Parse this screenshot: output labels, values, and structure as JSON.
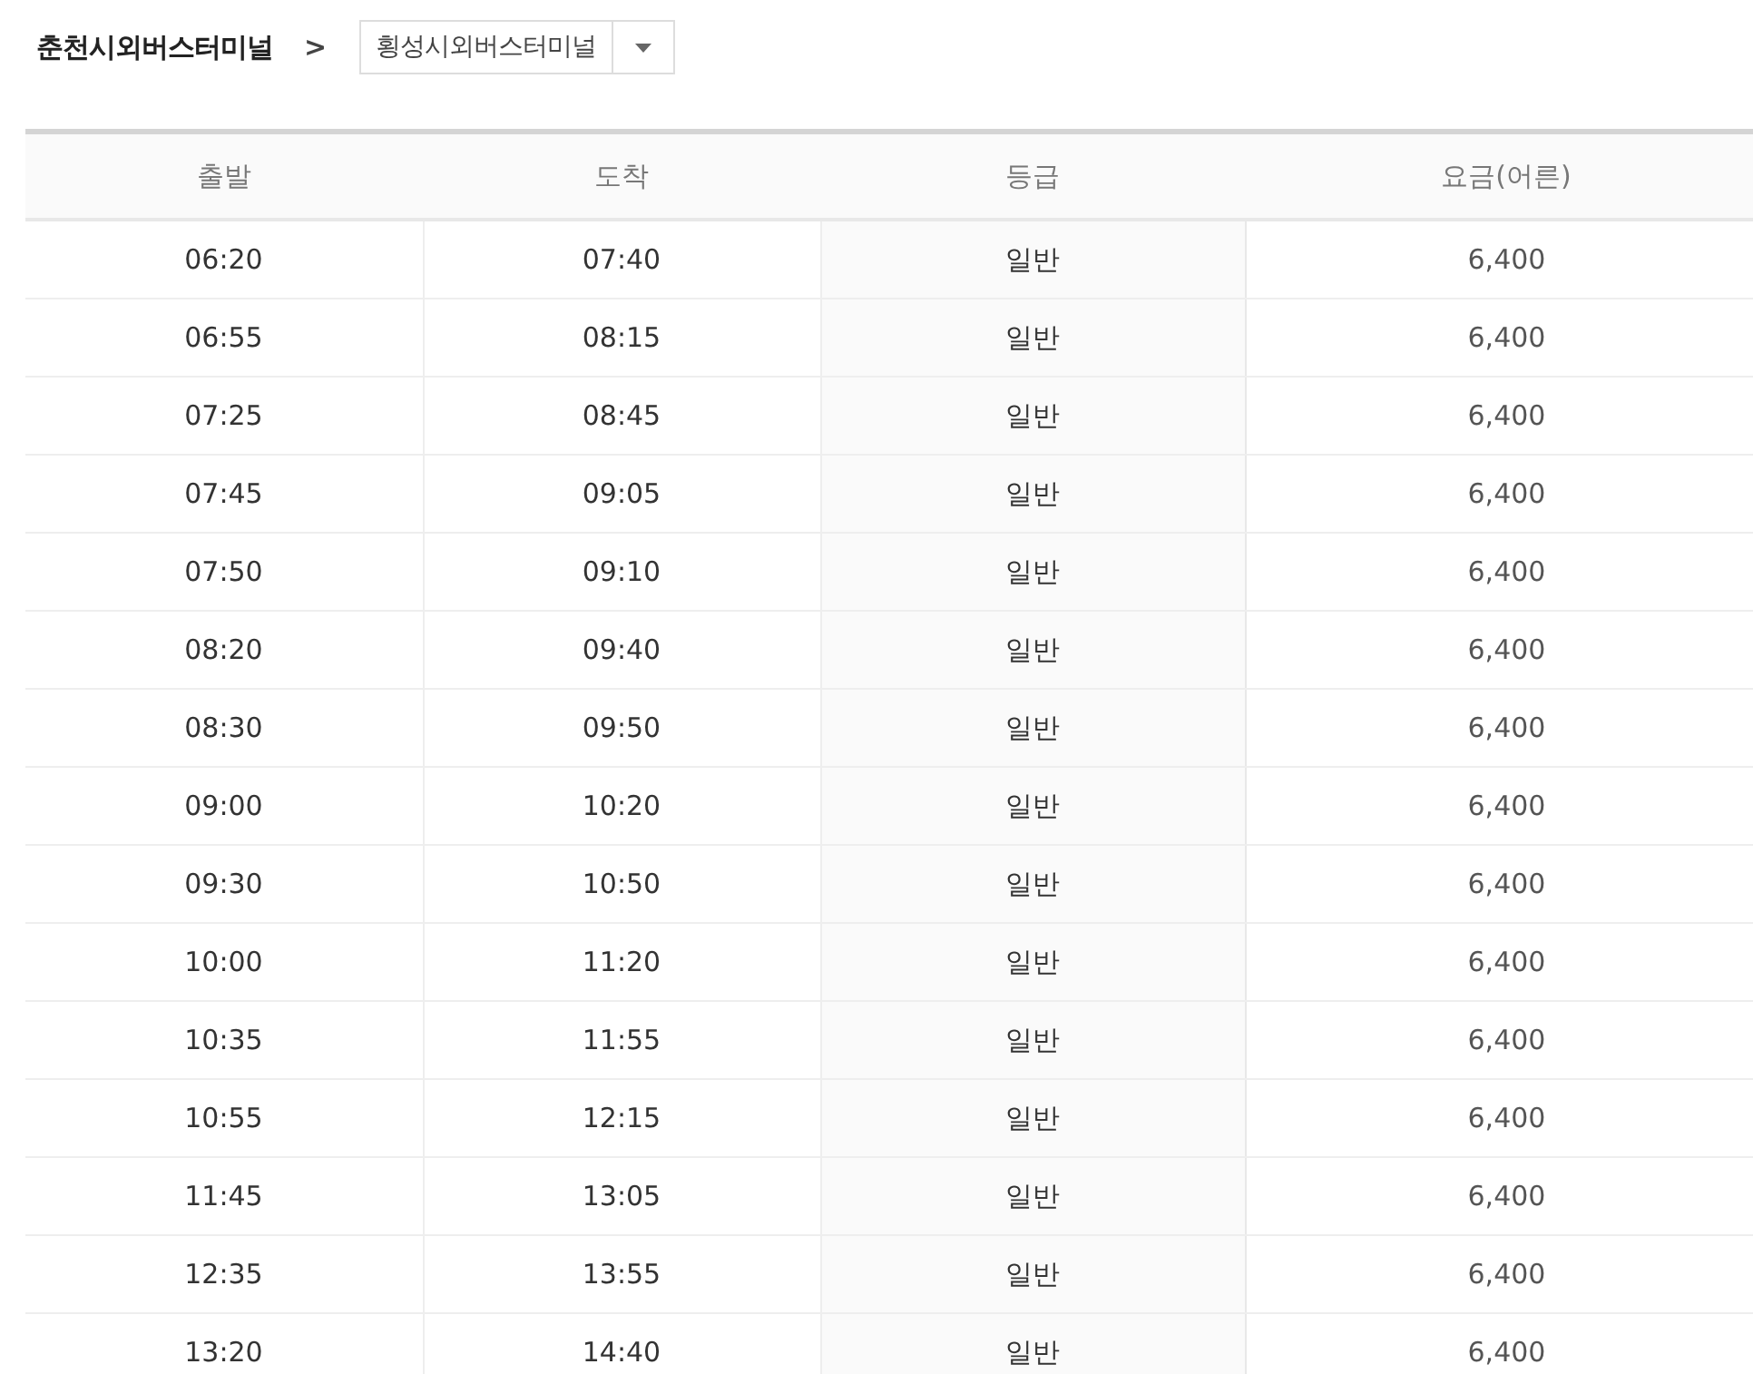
{
  "route": {
    "origin": "춘천시외버스터미널",
    "separator": ">",
    "destination": {
      "value": "횡성시외버스터미널"
    }
  },
  "table": {
    "columns": [
      "출발",
      "도착",
      "등급",
      "요금(어른)"
    ],
    "rows": [
      [
        "06:20",
        "07:40",
        "일반",
        "6,400"
      ],
      [
        "06:55",
        "08:15",
        "일반",
        "6,400"
      ],
      [
        "07:25",
        "08:45",
        "일반",
        "6,400"
      ],
      [
        "07:45",
        "09:05",
        "일반",
        "6,400"
      ],
      [
        "07:50",
        "09:10",
        "일반",
        "6,400"
      ],
      [
        "08:20",
        "09:40",
        "일반",
        "6,400"
      ],
      [
        "08:30",
        "09:50",
        "일반",
        "6,400"
      ],
      [
        "09:00",
        "10:20",
        "일반",
        "6,400"
      ],
      [
        "09:30",
        "10:50",
        "일반",
        "6,400"
      ],
      [
        "10:00",
        "11:20",
        "일반",
        "6,400"
      ],
      [
        "10:35",
        "11:55",
        "일반",
        "6,400"
      ],
      [
        "10:55",
        "12:15",
        "일반",
        "6,400"
      ],
      [
        "11:45",
        "13:05",
        "일반",
        "6,400"
      ],
      [
        "12:35",
        "13:55",
        "일반",
        "6,400"
      ],
      [
        "13:20",
        "14:40",
        "일반",
        "6,400"
      ]
    ]
  }
}
